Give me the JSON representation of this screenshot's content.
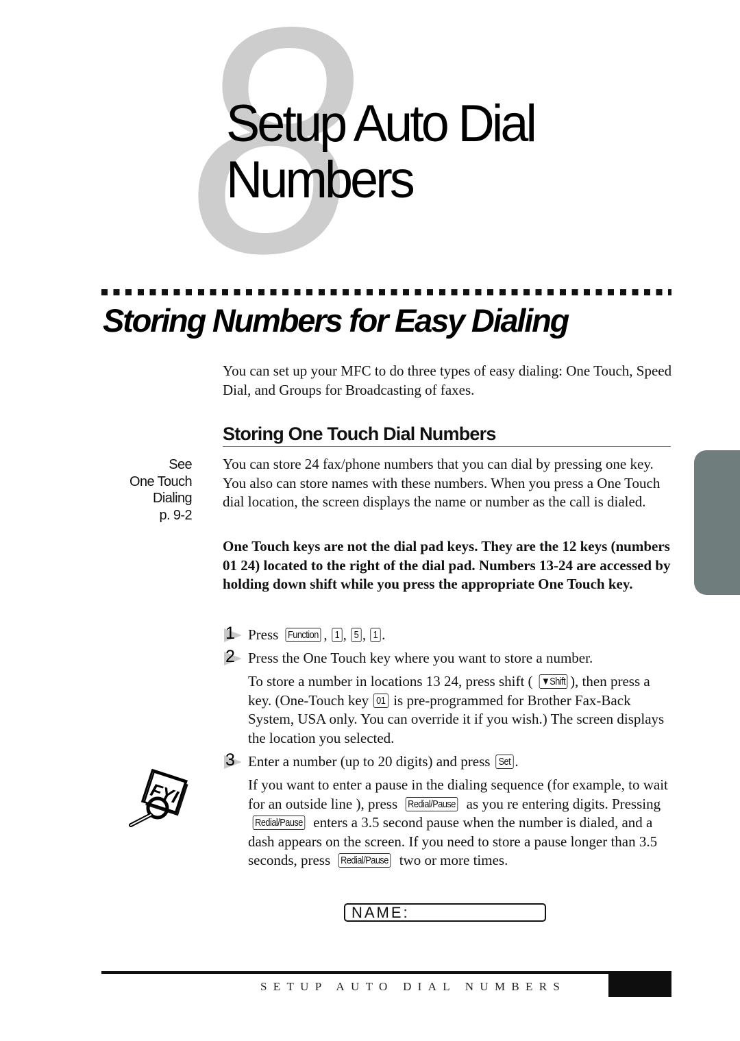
{
  "chapter": {
    "number": "8",
    "title_line1": "Setup Auto Dial",
    "title_line2": "Numbers"
  },
  "section": {
    "title": "Storing Numbers for Easy Dialing",
    "intro": "You can set up your MFC to do three types of easy dialing: One Touch, Speed Dial, and Groups for Broadcasting of faxes."
  },
  "subsection": {
    "title": "Storing One Touch Dial Numbers",
    "sidenote": [
      "See",
      "One Touch",
      "Dialing",
      "p. 9-2"
    ],
    "para1": "You can store 24 fax/phone numbers that you can dial by pressing one key. You also can store names with these numbers. When you press a One Touch dial location, the screen displays the name or number as the call is dialed.",
    "para_bold": "One Touch keys are not the dial pad keys. They are the 12 keys (numbers 01 24) located to the right of the dial pad. Numbers 13-24 are accessed by holding down shift while you press the appropriate One Touch key."
  },
  "steps": [
    {
      "number": "1",
      "text_before": "Press ",
      "keys": [
        "Function",
        "1",
        "5",
        "1"
      ],
      "text_after": "."
    },
    {
      "number": "2",
      "text": "Press the One Touch key where you want to store a number.",
      "sub": {
        "part1": "To store a number in locations 13 24, press shift ( ",
        "shift_key": "▼Shift",
        "part2": "), then press a key. (One-Touch key ",
        "key_01": "01",
        "part3": " is pre-programmed for Brother Fax-Back System, USA only. You can override it if you wish.) The screen displays the location you selected."
      }
    },
    {
      "number": "3",
      "text_before": "Enter a number (up to 20 digits) and press ",
      "key": "Set",
      "text_after": ".",
      "sub": {
        "part1": "If you want to enter a pause in the dialing sequence (for example, to wait for an  outside line ), press ",
        "key1": "Redial/Pause",
        "part2": " as you re entering digits. Pressing ",
        "key2": "Redial/Pause",
        "part3": " enters a 3.5 second pause when the number is dialed, and a dash appears on the screen. If you need to store a pause longer than 3.5 seconds, press ",
        "key3": "Redial/Pause",
        "part4": " two or more times."
      }
    }
  ],
  "fyi_icon": {
    "label": "FYI"
  },
  "lcd": {
    "text": "NAME:"
  },
  "footer": {
    "running_title": "SETUP AUTO DIAL NUMBERS"
  },
  "colors": {
    "side_tab": "#6f7e7d",
    "chapter_number": "#cdcdcd"
  }
}
